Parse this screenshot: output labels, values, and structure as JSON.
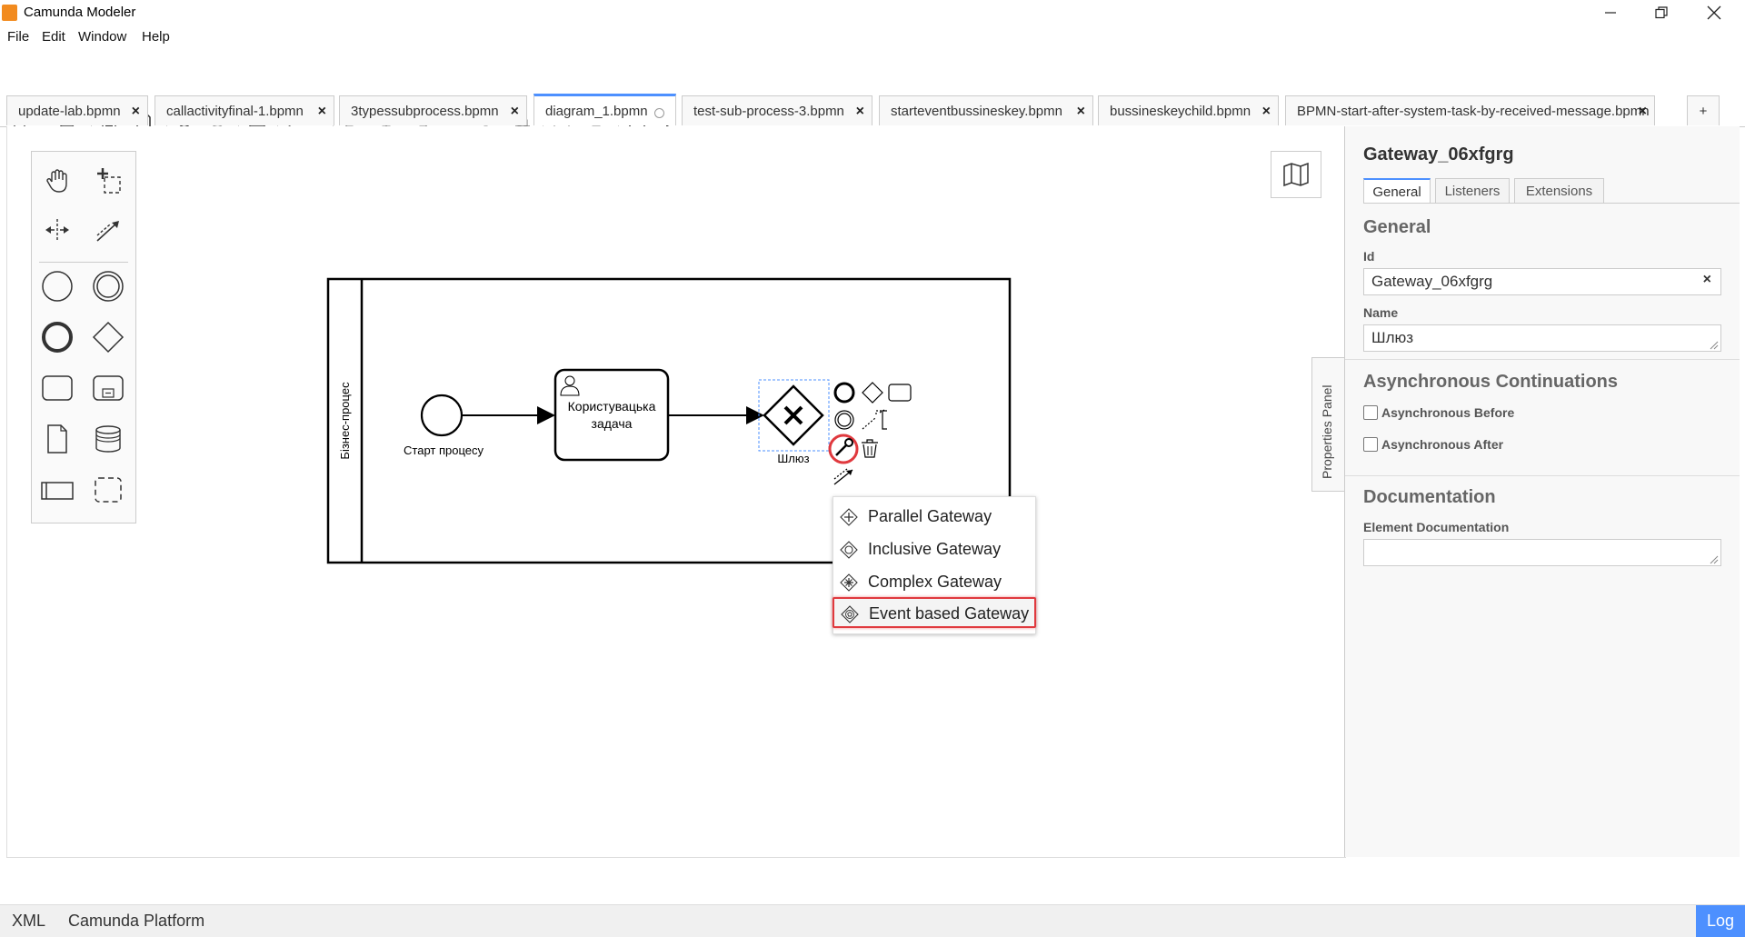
{
  "app": {
    "title": "Camunda Modeler"
  },
  "menu": {
    "items": [
      "File",
      "Edit",
      "Window",
      "Help"
    ]
  },
  "tabs": [
    {
      "label": "update-lab.bpmn",
      "close": "×"
    },
    {
      "label": "callactivityfinal-1.bpmn",
      "close": "×"
    },
    {
      "label": "3typessubprocess.bpmn",
      "close": "×"
    },
    {
      "label": "diagram_1.bpmn",
      "active": true
    },
    {
      "label": "test-sub-process-3.bpmn",
      "close": "×"
    },
    {
      "label": "starteventbussineskey.bpmn",
      "close": "×"
    },
    {
      "label": "bussineskeychild.bpmn",
      "close": "×"
    },
    {
      "label": "BPMN-start-after-system-task-by-received-message.bpmn",
      "close": "×"
    }
  ],
  "new_tab_label": "+",
  "diagram": {
    "pool_label": "Бізнес-процес",
    "start_event_label": "Старт процесу",
    "user_task_label_line1": "Користувацька",
    "user_task_label_line2": "задача",
    "gateway_label": "Шлюз"
  },
  "replace_menu": {
    "items": [
      {
        "label": "Parallel Gateway",
        "icon": "parallel-gateway-icon"
      },
      {
        "label": "Inclusive Gateway",
        "icon": "inclusive-gateway-icon"
      },
      {
        "label": "Complex Gateway",
        "icon": "complex-gateway-icon"
      },
      {
        "label": "Event based Gateway",
        "icon": "event-based-gateway-icon",
        "highlighted": true
      }
    ]
  },
  "properties_toggle_label": "Properties Panel",
  "properties": {
    "element_title": "Gateway_06xfgrg",
    "tabs": [
      "General",
      "Listeners",
      "Extensions"
    ],
    "active_tab": "General",
    "general_header": "General",
    "id_label": "Id",
    "id_value": "Gateway_06xfgrg",
    "clear_symbol": "×",
    "name_label": "Name",
    "name_value": "Шлюз",
    "async_header": "Asynchronous Continuations",
    "async_before": "Asynchronous Before",
    "async_after": "Asynchronous After",
    "doc_header": "Documentation",
    "doc_label": "Element Documentation",
    "doc_value": ""
  },
  "statusbar": {
    "xml": "XML",
    "platform": "Camunda Platform",
    "log": "Log"
  },
  "colors": {
    "accent": "#4d90ff",
    "highlight_red": "#e0393e",
    "logo_orange": "#f28b1f"
  }
}
